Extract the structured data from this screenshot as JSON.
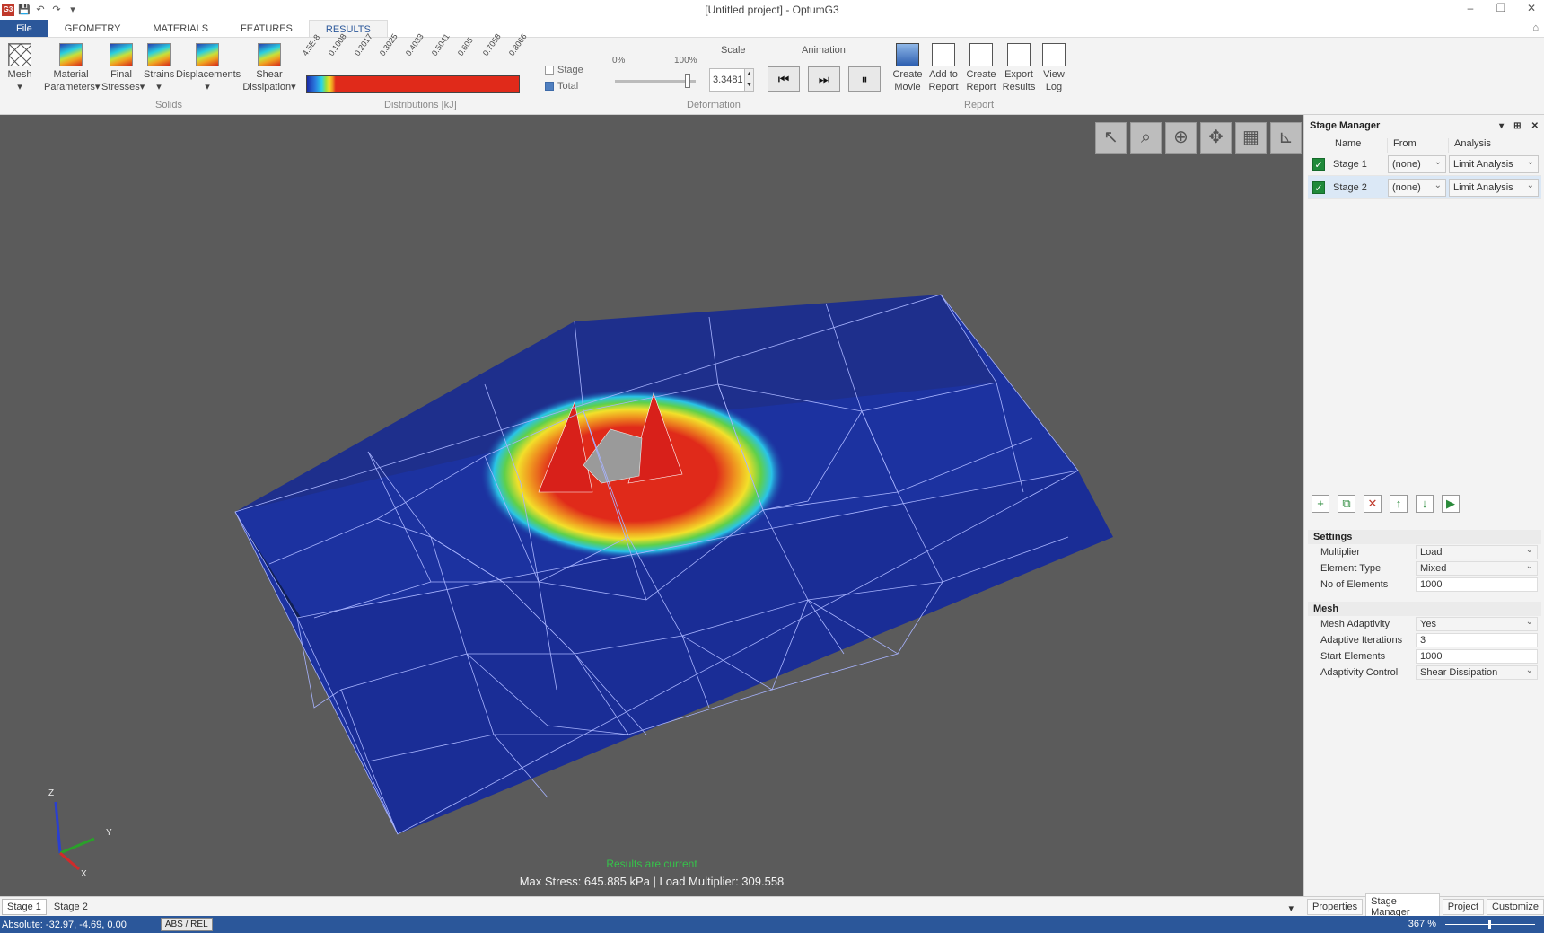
{
  "window": {
    "title": "[Untitled project] - OptumG3",
    "controls": [
      "–",
      "❐",
      "✕"
    ]
  },
  "quick_access": [
    "G3",
    "💾",
    "↶",
    "↷",
    "▾"
  ],
  "tabs": [
    "File",
    "GEOMETRY",
    "MATERIALS",
    "FEATURES",
    "RESULTS"
  ],
  "active_tab": "RESULTS",
  "ribbon": {
    "mesh": {
      "line1": "Mesh",
      "line2": "▾"
    },
    "material_parameters": {
      "line1": "Material",
      "line2": "Parameters▾"
    },
    "final_stresses": {
      "line1": "Final",
      "line2": "Stresses▾"
    },
    "strains": {
      "line1": "Strains",
      "line2": "▾"
    },
    "displacements": {
      "line1": "Displacements",
      "line2": "▾"
    },
    "shear_dissipation": {
      "line1": "Shear",
      "line2": "Dissipation▾"
    },
    "group_solids": "Solids",
    "distribution_ticks": [
      "4.5E-8",
      "0.1008",
      "0.2017",
      "0.3025",
      "0.4033",
      "0.5041",
      "0.605",
      "0.7058",
      "0.8066"
    ],
    "group_distributions": "Distributions [kJ]",
    "stage_label": "Stage",
    "total_label": "Total",
    "total_checked": true,
    "stage_checked": false,
    "slider_min": "0%",
    "slider_max": "100%",
    "slider_value": 0.9,
    "scale_label": "Scale",
    "scale_value": "3.3481",
    "group_deformation": "Deformation",
    "animation_label": "Animation",
    "create_movie": {
      "line1": "Create",
      "line2": "Movie"
    },
    "add_to_report": {
      "line1": "Add to",
      "line2": "Report"
    },
    "create_report": {
      "line1": "Create",
      "line2": "Report"
    },
    "export_results": {
      "line1": "Export",
      "line2": "Results"
    },
    "view_log": {
      "line1": "View",
      "line2": "Log"
    },
    "group_report": "Report"
  },
  "viewport": {
    "status_current": "Results are current",
    "status_summary": "Max Stress:  645.885 kPa | Load Multiplier:  309.558",
    "axis_z": "Z",
    "axis_y": "Y",
    "axis_x": "X"
  },
  "stage_manager": {
    "title": "Stage Manager",
    "columns": [
      "Name",
      "From",
      "Analysis"
    ],
    "rows": [
      {
        "name": "Stage 1",
        "from": "(none)",
        "analysis": "Limit Analysis",
        "checked": true
      },
      {
        "name": "Stage 2",
        "from": "(none)",
        "analysis": "Limit Analysis",
        "checked": true
      }
    ],
    "settings": {
      "header": "Settings",
      "rows": [
        {
          "label": "Multiplier",
          "value": "Load"
        },
        {
          "label": "Element Type",
          "value": "Mixed"
        },
        {
          "label": "No of Elements",
          "value": "1000"
        }
      ]
    },
    "mesh": {
      "header": "Mesh",
      "rows": [
        {
          "label": "Mesh Adaptivity",
          "value": "Yes"
        },
        {
          "label": "Adaptive Iterations",
          "value": "3"
        },
        {
          "label": "Start Elements",
          "value": "1000"
        },
        {
          "label": "Adaptivity Control",
          "value": "Shear Dissipation"
        }
      ]
    }
  },
  "panel_tabs": [
    "Properties",
    "Stage Manager",
    "Project",
    "Customize"
  ],
  "stage_tabs": [
    "Stage 1",
    "Stage 2"
  ],
  "statusbar": {
    "coords": "Absolute: -32.97, -4.69, 0.00",
    "absrel": "ABS / REL",
    "zoom": "367 %"
  },
  "colors": {
    "accent": "#2b579a",
    "viewport_bg": "#5b5b5b",
    "mesh_blue": "#1c32a0",
    "hot": "#e02a1a",
    "status_green": "#36c24a"
  }
}
